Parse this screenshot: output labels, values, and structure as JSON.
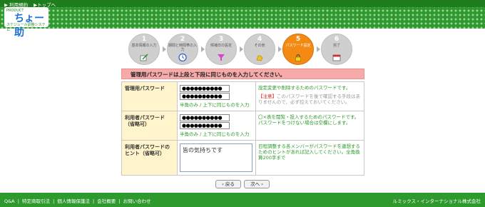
{
  "header": {
    "links": [
      "▶ 利用規約",
      "▶トップへ"
    ],
    "logo_top": "PRODUCT",
    "logo_main": "ちょー助",
    "logo_bottom": "スケジュール調整システム"
  },
  "steps": [
    {
      "num": "1",
      "label": "基本情報の入力"
    },
    {
      "num": "2",
      "label": "期間と時間帯の入力"
    },
    {
      "num": "3",
      "label": "候補日の設定"
    },
    {
      "num": "4",
      "label": "その他"
    },
    {
      "num": "5",
      "label": "パスワード設定"
    },
    {
      "num": "6",
      "label": "完了"
    }
  ],
  "notice": "管理用パスワードは上段と下段に同じものを入力してください。",
  "rows": {
    "admin": {
      "label": "管理用パスワード",
      "value1": "●●●●●●●●●●",
      "value2": "●●●●●●●●●●",
      "hint": "半角のみ / 上下に同じものを入力",
      "desc": "設定変更や削除するためのパスワードです。",
      "warn_tag": "【注意】",
      "warn_text": "このパスワードを後で確認する手段はありませんので、必ず控えておいてください。"
    },
    "user": {
      "label": "利用者パスワード（省略可）",
      "value1": "●●●●●●●●●●",
      "value2": "●●●●●●●●●●",
      "hint": "半角のみ / 上下に同じものを入力",
      "desc": "〇×表を閲覧・投入するためのパスワードです。パスワードをつけない場合は空欄にします。"
    },
    "hintrow": {
      "label": "利用者パスワードのヒント（省略可）",
      "value": "皆の気持ちです",
      "desc": "日程調整する各メンバーがパスワードを連想するためのヒントがあれば記入してください。全角換算200字まで"
    }
  },
  "buttons": {
    "back": "戻る",
    "next": "次へ"
  },
  "footer": {
    "links": [
      "Q&A",
      "|",
      "特定商取引法",
      "|",
      "個人情報保護法",
      "|",
      "会社概要",
      "|",
      "お問い合わせ"
    ],
    "copyright": "ルミックス・インターナショナル株式会社"
  }
}
